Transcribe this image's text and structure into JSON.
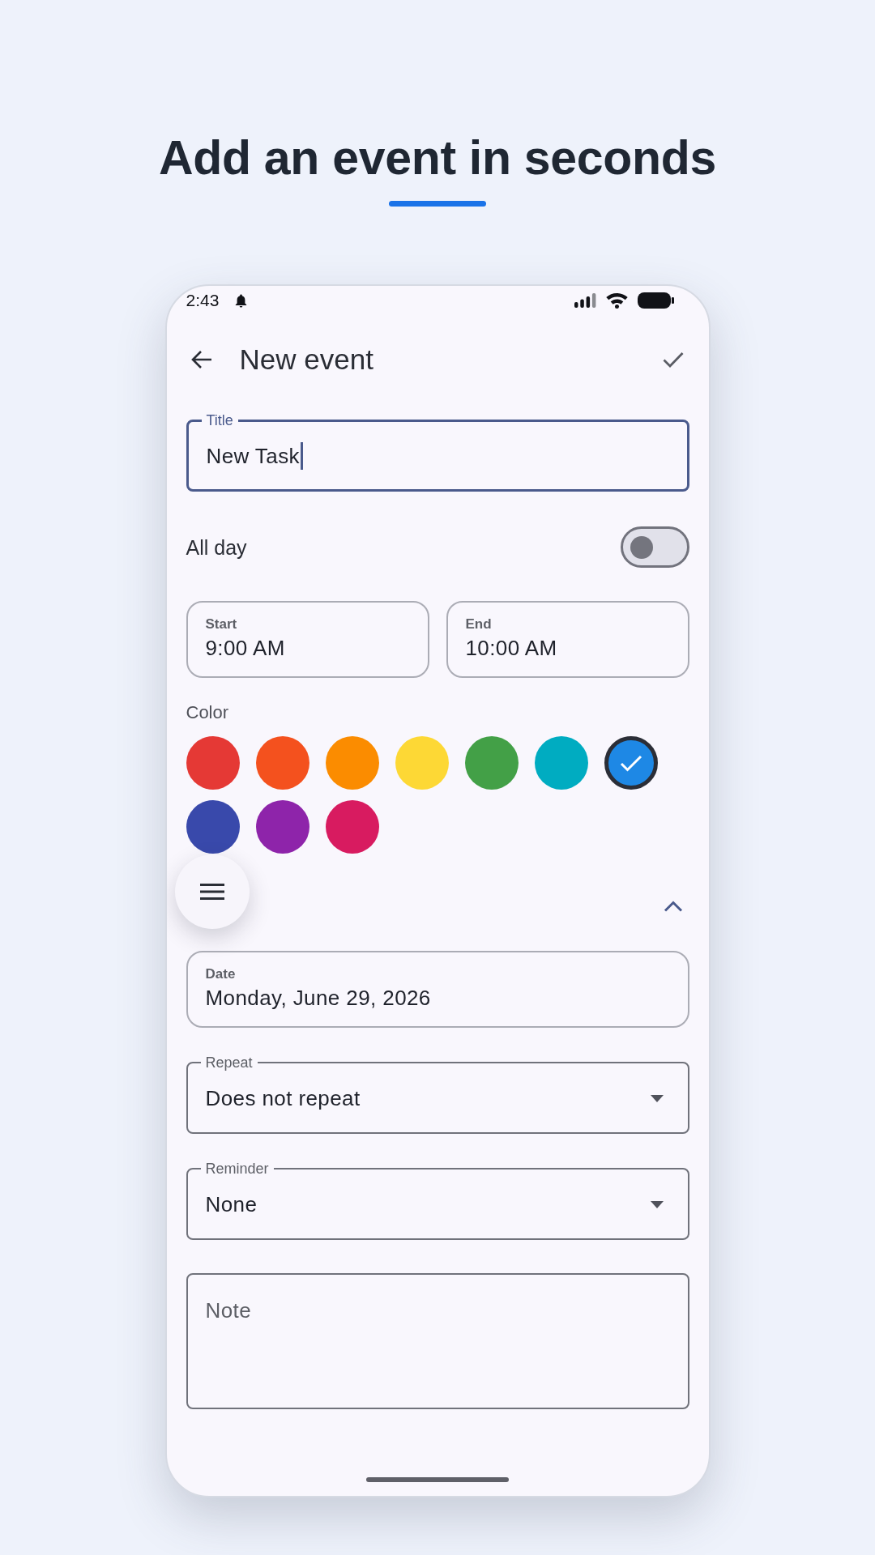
{
  "headline": {
    "text": "Add an event in seconds"
  },
  "status_bar": {
    "time": "2:43"
  },
  "app_bar": {
    "title": "New event"
  },
  "title_field": {
    "label": "Title",
    "value": "New Task",
    "focused": true
  },
  "all_day": {
    "label": "All day",
    "on": false
  },
  "times": [
    {
      "label": "Start",
      "value": "9:00 AM"
    },
    {
      "label": "End",
      "value": "10:00 AM"
    }
  ],
  "color_picker": {
    "label": "Color",
    "swatches": [
      {
        "color": "#e53935",
        "selected": false
      },
      {
        "color": "#f4511e",
        "selected": false
      },
      {
        "color": "#fb8c00",
        "selected": false
      },
      {
        "color": "#fdd835",
        "selected": false
      },
      {
        "color": "#43a047",
        "selected": false
      },
      {
        "color": "#00acc1",
        "selected": false
      },
      {
        "color": "#1e88e5",
        "selected": true
      },
      {
        "color": "#3949ab",
        "selected": false
      },
      {
        "color": "#8e24aa",
        "selected": false
      },
      {
        "color": "#d81b60",
        "selected": false
      }
    ]
  },
  "more_section": {
    "expanded": true
  },
  "date_field": {
    "label": "Date",
    "value": "Monday, June 29, 2026"
  },
  "dropdowns": [
    {
      "label": "Repeat",
      "value": "Does not repeat"
    },
    {
      "label": "Reminder",
      "value": "None"
    }
  ],
  "note_field": {
    "placeholder": "Note"
  }
}
